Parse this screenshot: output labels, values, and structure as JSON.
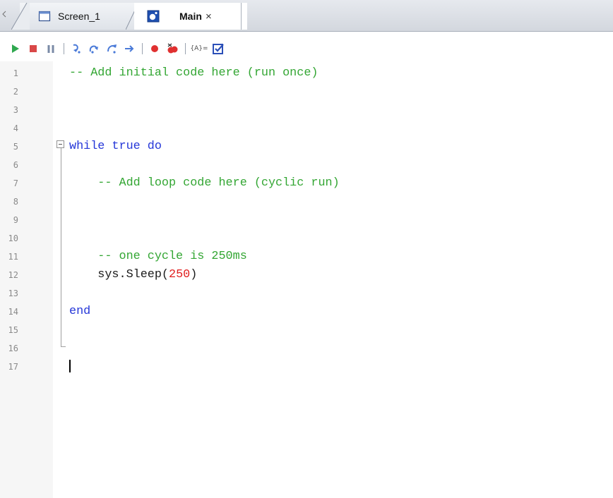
{
  "tabs": [
    {
      "label": "Screen_1",
      "icon": "screen-window-icon",
      "active": false
    },
    {
      "label": "Main",
      "icon": "script-file-icon",
      "active": true,
      "close": "×"
    }
  ],
  "toolbar": {
    "buttons": [
      {
        "name": "run",
        "icon": "play-icon",
        "color": "#2fa84f"
      },
      {
        "name": "stop",
        "icon": "stop-icon",
        "color": "#d94848"
      },
      {
        "name": "pause",
        "icon": "pause-icon",
        "color": "#7a8aa6"
      },
      {
        "name": "step-into",
        "icon": "step-into-icon",
        "color": "#4a7ad8"
      },
      {
        "name": "step-over",
        "icon": "step-over-icon",
        "color": "#4a7ad8"
      },
      {
        "name": "step-out",
        "icon": "step-out-icon",
        "color": "#4a7ad8"
      },
      {
        "name": "run-to-cursor",
        "icon": "arrow-right-icon",
        "color": "#4a7ad8"
      },
      {
        "name": "toggle-breakpoint",
        "icon": "breakpoint-icon",
        "color": "#e03030"
      },
      {
        "name": "clear-breakpoints",
        "icon": "clear-breakpoints-icon",
        "color": "#e03030"
      },
      {
        "name": "watch-variables",
        "icon": "variables-icon",
        "color": "#4a4a4a",
        "text": "{A}="
      },
      {
        "name": "check-syntax",
        "icon": "checkbox-icon",
        "color": "#2b4fb8"
      }
    ]
  },
  "editor": {
    "line_numbers": [
      "1",
      "2",
      "3",
      "4",
      "5",
      "6",
      "7",
      "8",
      "9",
      "10",
      "11",
      "12",
      "13",
      "14",
      "15",
      "16",
      "17"
    ],
    "lines": [
      [
        {
          "t": "-- Add initial code here (run once)",
          "k": "comment"
        }
      ],
      [],
      [],
      [],
      [
        {
          "t": "while true do",
          "k": "keyword"
        }
      ],
      [],
      [
        {
          "t": "    -- Add loop code here (cyclic run)",
          "k": "comment"
        }
      ],
      [],
      [],
      [],
      [
        {
          "t": "    -- one cycle is 250ms",
          "k": "comment"
        }
      ],
      [
        {
          "t": "    sys.Sleep(",
          "k": "plain"
        },
        {
          "t": "250",
          "k": "number"
        },
        {
          "t": ")",
          "k": "plain"
        }
      ],
      [],
      [
        {
          "t": "end",
          "k": "keyword"
        }
      ],
      [],
      [],
      []
    ],
    "colors": {
      "comment": "#33a633",
      "keyword": "#2436d8",
      "number": "#e02020",
      "plain": "#1a1a1a"
    }
  }
}
